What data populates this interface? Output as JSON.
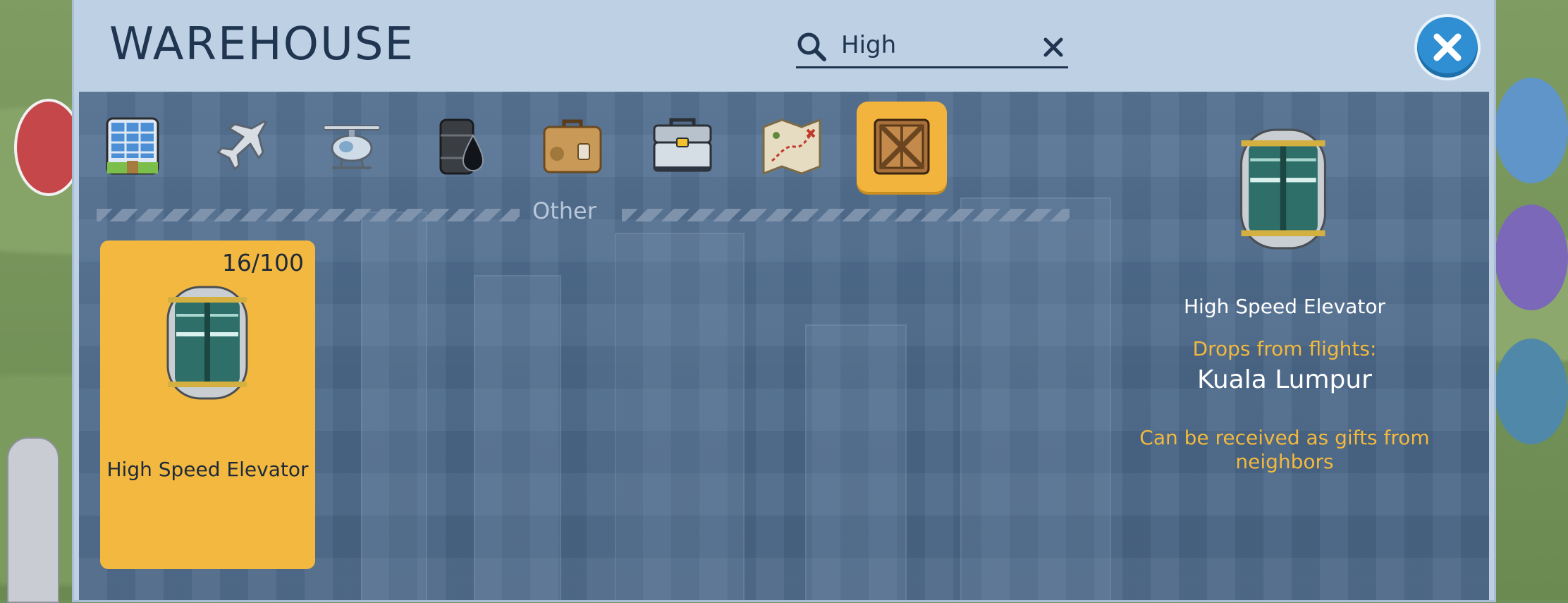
{
  "window": {
    "title": "WAREHOUSE"
  },
  "search": {
    "value": "High",
    "icon": "search-icon",
    "clear_icon": "clear-icon"
  },
  "close": {
    "icon": "close-icon"
  },
  "tabs": [
    {
      "name": "buildings",
      "icon": "building-icon",
      "active": false
    },
    {
      "name": "airplane",
      "icon": "airplane-icon",
      "active": false
    },
    {
      "name": "helicopter",
      "icon": "helicopter-icon",
      "active": false
    },
    {
      "name": "oil",
      "icon": "oil-barrel-icon",
      "active": false
    },
    {
      "name": "suitcase",
      "icon": "suitcase-icon",
      "active": false
    },
    {
      "name": "toolbox",
      "icon": "toolbox-icon",
      "active": false
    },
    {
      "name": "map",
      "icon": "treasure-map-icon",
      "active": false
    },
    {
      "name": "other",
      "icon": "crate-icon",
      "active": true
    }
  ],
  "category_label": "Other",
  "items": [
    {
      "name": "High Speed Elevator",
      "count": "16/100",
      "icon": "elevator-icon"
    }
  ],
  "details": {
    "name": "High Speed Elevator",
    "drops_label": "Drops from flights:",
    "drops_city": "Kuala Lumpur",
    "gift_note": "Can be received as gifts from neighbors"
  },
  "colors": {
    "accent": "#f2b43c",
    "panel": "#4f6b8c",
    "frame": "#bdd0e4",
    "close": "#2f8fd2",
    "highlight_text": "#f2b93e"
  }
}
